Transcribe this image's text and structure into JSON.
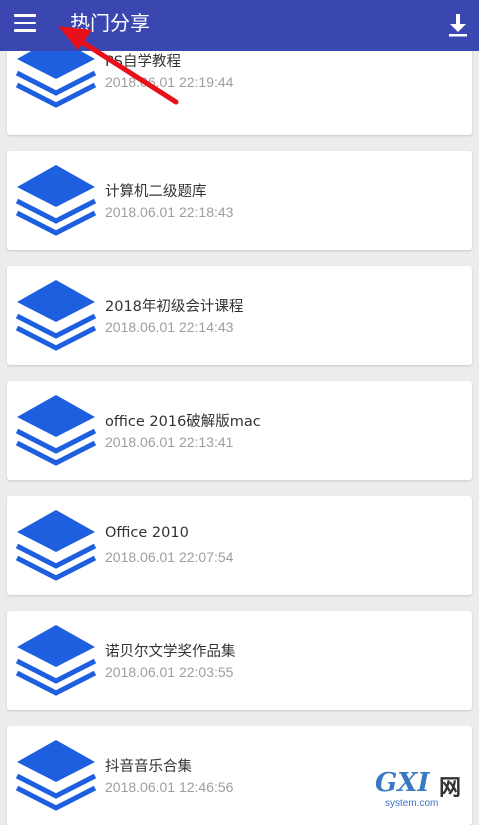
{
  "header": {
    "title": "热门分享",
    "menu_icon": "hamburger-menu-icon",
    "download_icon": "download-icon",
    "color": "#3a47b0"
  },
  "items": [
    {
      "name": "PS自学教程",
      "time": "2018.06.01 22:19:44"
    },
    {
      "name": "计算机二级题库",
      "time": "2018.06.01 22:18:43"
    },
    {
      "name": "2018年初级会计课程",
      "time": "2018.06.01 22:14:43"
    },
    {
      "name": "office 2016破解版mac",
      "time": "2018.06.01 22:13:41"
    },
    {
      "name": "Office 2010",
      "time": "2018.06.01 22:07:54"
    },
    {
      "name": "诺贝尔文学奖作品集",
      "time": "2018.06.01 22:03:55"
    },
    {
      "name": "抖音音乐合集",
      "time": "2018.06.01 12:46:56"
    }
  ],
  "item_icon": "layers-stack-icon",
  "icon_color": "#1e5fe0",
  "annotation": {
    "icon": "red-arrow-icon",
    "color": "#e8101a"
  },
  "watermark": {
    "logo": "GXI",
    "cn": "网",
    "sub": "system.com"
  }
}
